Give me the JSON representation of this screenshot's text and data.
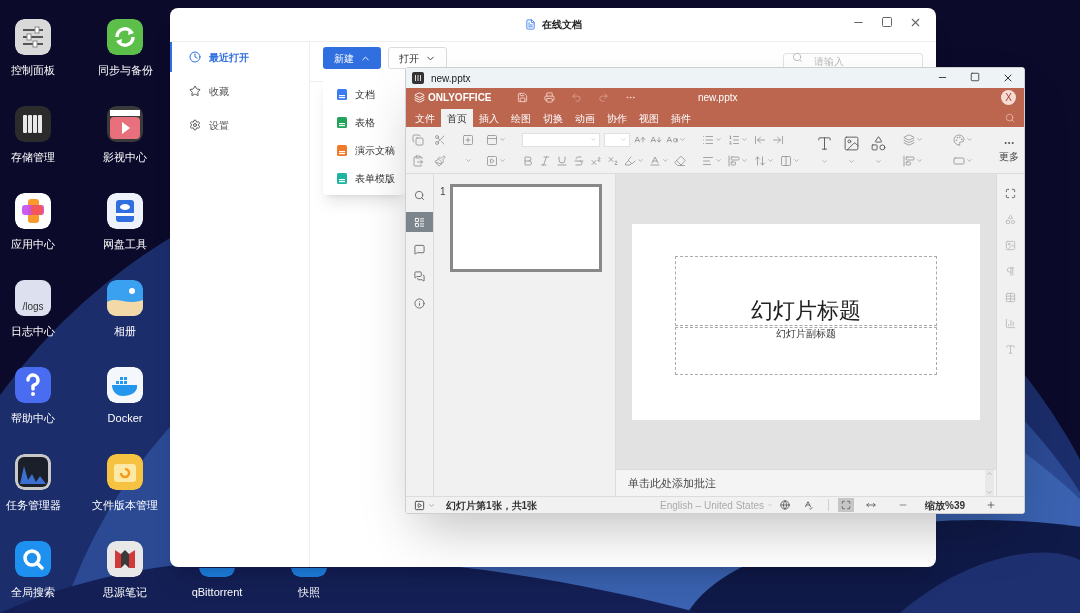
{
  "desktop_icons": [
    {
      "label": "控制面板"
    },
    {
      "label": "同步与备份"
    },
    {
      "label": "存储管理"
    },
    {
      "label": "影视中心"
    },
    {
      "label": "应用中心"
    },
    {
      "label": "网盘工具"
    },
    {
      "label": "日志中心",
      "icon_text": "/logs"
    },
    {
      "label": "相册"
    },
    {
      "label": "帮助中心"
    },
    {
      "label": "Docker"
    },
    {
      "label": "任务管理器"
    },
    {
      "label": "文件版本管理"
    },
    {
      "label": "全局搜索"
    },
    {
      "label": "思源笔记"
    },
    {
      "label": "qBittorrent"
    },
    {
      "label": "快照"
    }
  ],
  "docs_window": {
    "title": "在线文档",
    "nav": [
      {
        "label": "最近打开",
        "selected": true
      },
      {
        "label": "收藏",
        "selected": false
      },
      {
        "label": "设置",
        "selected": false
      }
    ],
    "new_button": {
      "label": "新建",
      "expanded": true
    },
    "open_button": "打开",
    "search": {
      "placeholder": "请输入"
    },
    "new_menu": [
      {
        "label": "文档",
        "color": "#3b7cf0"
      },
      {
        "label": "表格",
        "color": "#22a35a"
      },
      {
        "label": "演示文稿",
        "color": "#f07a2b"
      },
      {
        "label": "表单模版",
        "color": "#1fb3a1"
      }
    ]
  },
  "editor": {
    "window_title": "new.pptx",
    "brand": "ONLYOFFICE",
    "doc_title": "new.pptx",
    "user_initial": "X",
    "tabs": [
      {
        "label": "文件",
        "selected": false
      },
      {
        "label": "首页",
        "selected": true
      },
      {
        "label": "插入",
        "selected": false
      },
      {
        "label": "绘图",
        "selected": false
      },
      {
        "label": "切换",
        "selected": false
      },
      {
        "label": "动画",
        "selected": false
      },
      {
        "label": "协作",
        "selected": false
      },
      {
        "label": "视图",
        "selected": false
      },
      {
        "label": "插件",
        "selected": false
      }
    ],
    "more_label": "更多",
    "side_tools": [
      {
        "selected": false
      },
      {
        "selected": true
      },
      {
        "selected": false
      },
      {
        "selected": false
      },
      {
        "selected": false
      }
    ],
    "slides": [
      {
        "number": "1",
        "selected": true
      }
    ],
    "slide": {
      "title": "幻灯片标题",
      "subtitle": "幻灯片副标题"
    },
    "notes_placeholder": "单击此处添加批注",
    "status": {
      "slide_info": "幻灯片第1张，共1张",
      "language": "English – United States",
      "zoom": "缩放%39",
      "view_buttons": [
        {
          "selected": true
        },
        {
          "selected": false
        }
      ]
    }
  }
}
